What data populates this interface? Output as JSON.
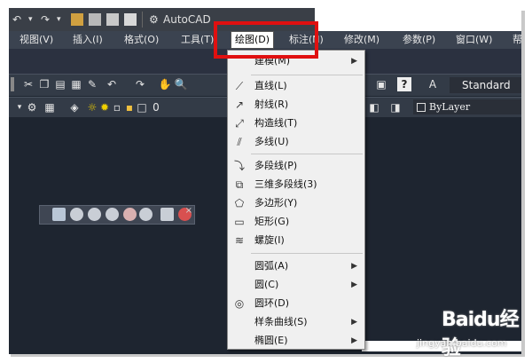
{
  "qat": {
    "undo": "↶",
    "redo": "↷",
    "dropdown": "▾",
    "app_title": "AutoCAD"
  },
  "menubar": {
    "items": [
      {
        "label": "视图(V)"
      },
      {
        "label": "插入(I)"
      },
      {
        "label": "格式(O)"
      },
      {
        "label": "工具(T)"
      },
      {
        "label": "绘图(D)"
      },
      {
        "label": "标注(N)"
      },
      {
        "label": "修改(M)"
      },
      {
        "label": "参数(P)"
      },
      {
        "label": "窗口(W)"
      },
      {
        "label": "帮"
      }
    ]
  },
  "toolbar": {
    "style_value": "Standard",
    "layer_value": "0",
    "linetype_value": "ByLayer"
  },
  "dropdown": {
    "items": [
      {
        "label": "建模(M)",
        "submenu": true,
        "icon": ""
      },
      {
        "label": "直线(L)",
        "submenu": false,
        "icon": "line-icon"
      },
      {
        "label": "射线(R)",
        "submenu": false,
        "icon": "ray-icon"
      },
      {
        "label": "构造线(T)",
        "submenu": false,
        "icon": "xline-icon"
      },
      {
        "label": "多线(U)",
        "submenu": false,
        "icon": "mline-icon"
      },
      {
        "label": "多段线(P)",
        "submenu": false,
        "icon": "pline-icon"
      },
      {
        "label": "三维多段线(3)",
        "submenu": false,
        "icon": "3dpoly-icon"
      },
      {
        "label": "多边形(Y)",
        "submenu": false,
        "icon": "polygon-icon"
      },
      {
        "label": "矩形(G)",
        "submenu": false,
        "icon": "rectangle-icon"
      },
      {
        "label": "螺旋(I)",
        "submenu": false,
        "icon": "helix-icon"
      },
      {
        "label": "圆弧(A)",
        "submenu": true,
        "icon": ""
      },
      {
        "label": "圆(C)",
        "submenu": true,
        "icon": ""
      },
      {
        "label": "圆环(D)",
        "submenu": false,
        "icon": "donut-icon"
      },
      {
        "label": "样条曲线(S)",
        "submenu": true,
        "icon": ""
      },
      {
        "label": "椭圆(E)",
        "submenu": true,
        "icon": ""
      }
    ],
    "arrow": "▶"
  },
  "watermark": {
    "brand": "Baidu经验",
    "url": "jingyan.baidu.com"
  },
  "colors": {
    "highlight": "#e01010",
    "menu_bg": "#f0f0f0",
    "canvas": "#1e2530"
  }
}
